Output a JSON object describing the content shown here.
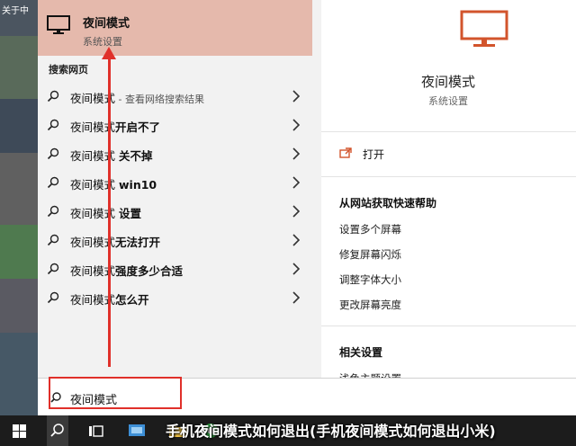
{
  "desktop": {
    "label": "关于中"
  },
  "best_match": {
    "title": "夜间模式",
    "subtitle": "系统设置"
  },
  "web_section_label": "搜索网页",
  "suggestions": [
    {
      "prefix": "夜间模式",
      "bold": "",
      "hint": " - 查看网络搜索结果"
    },
    {
      "prefix": "夜间模式",
      "bold": "开启不了",
      "hint": ""
    },
    {
      "prefix": "夜间模式 ",
      "bold": "关不掉",
      "hint": ""
    },
    {
      "prefix": "夜间模式 ",
      "bold": "win10",
      "hint": ""
    },
    {
      "prefix": "夜间模式 ",
      "bold": "设置",
      "hint": ""
    },
    {
      "prefix": "夜间模式",
      "bold": "无法打开",
      "hint": ""
    },
    {
      "prefix": "夜间模式",
      "bold": "强度多少合适",
      "hint": ""
    },
    {
      "prefix": "夜间模式",
      "bold": "怎么开",
      "hint": ""
    }
  ],
  "detail": {
    "title": "夜间模式",
    "subtitle": "系统设置",
    "open_label": "打开",
    "web_help_heading": "从网站获取快速帮助",
    "help_links": [
      "设置多个屏幕",
      "修复屏幕闪烁",
      "调整字体大小",
      "更改屏幕亮度"
    ],
    "related_heading": "相关设置",
    "related_links": [
      "浅色主题设置"
    ]
  },
  "search": {
    "query": "夜间模式"
  },
  "caption": "手机夜间模式如何退出(手机夜间模式如何退出小米)",
  "colors": {
    "highlight": "#e5b9ac",
    "accent": "#d2542c",
    "annotation": "#e0302a"
  }
}
